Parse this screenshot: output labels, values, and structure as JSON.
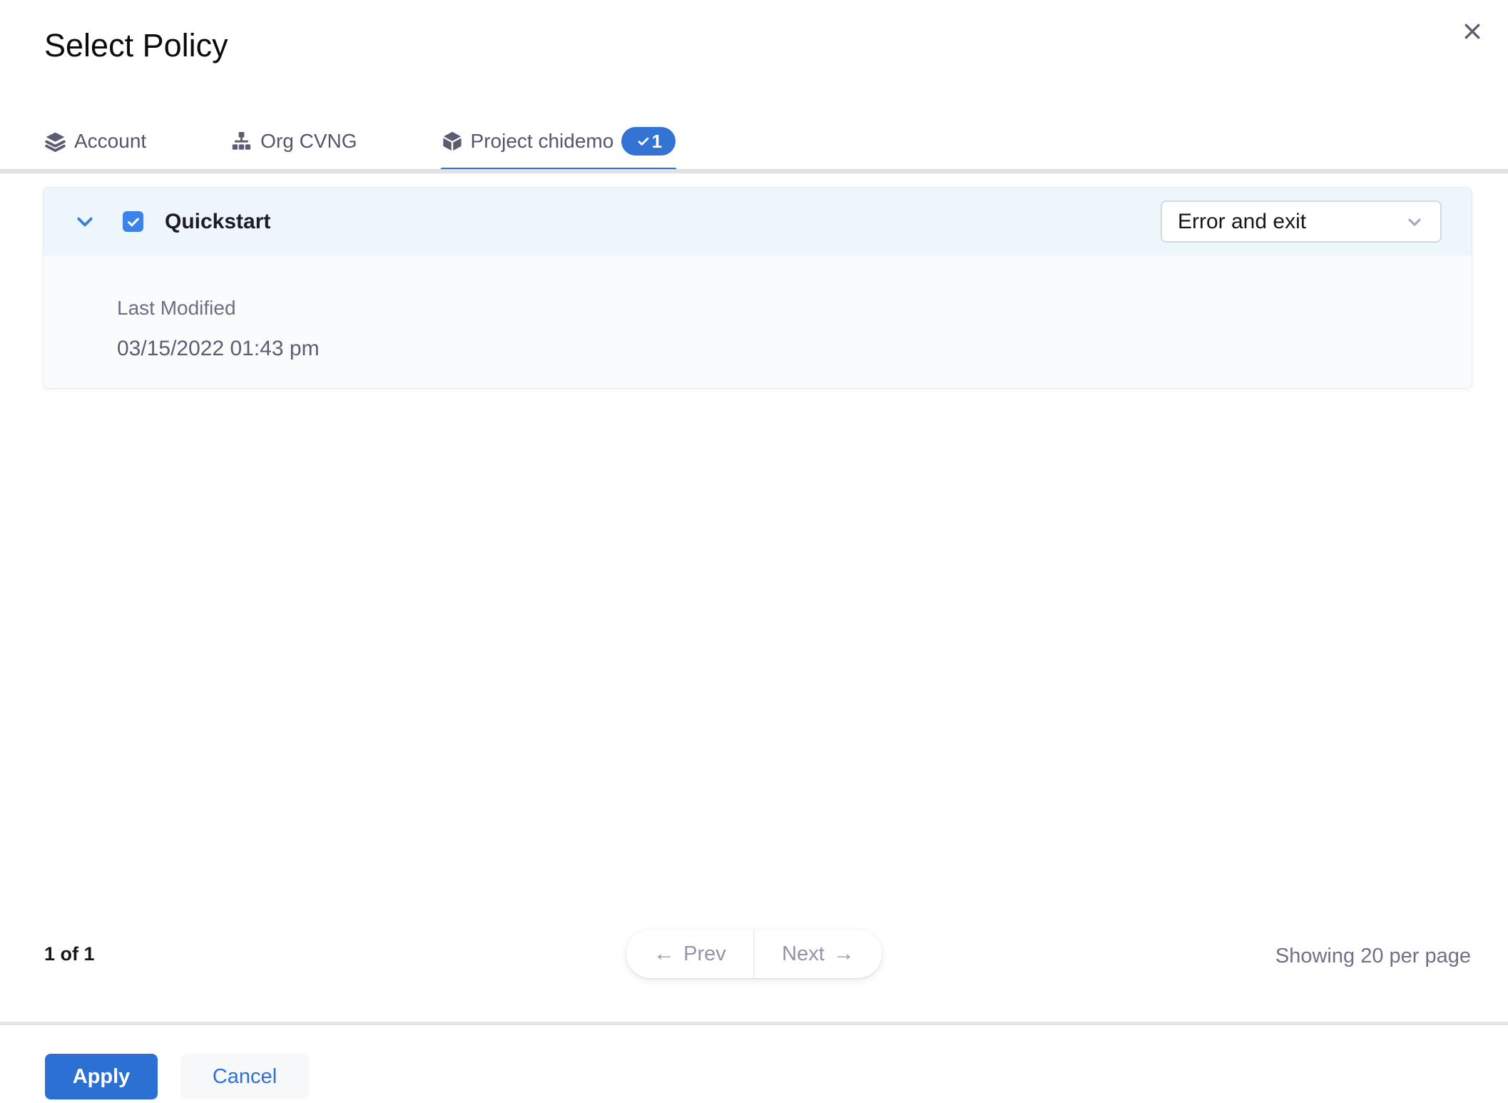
{
  "modal": {
    "title": "Select Policy"
  },
  "tabs": [
    {
      "label": "Account"
    },
    {
      "label": "Org CVNG"
    },
    {
      "label": "Project chidemo",
      "badge_count": "1"
    }
  ],
  "policy_row": {
    "name": "Quickstart",
    "action_select": {
      "value": "Error and exit"
    },
    "details": {
      "label": "Last Modified",
      "value": "03/15/2022 01:43 pm"
    }
  },
  "pagination": {
    "page_indicator": "1 of 1",
    "prev_label": "Prev",
    "next_label": "Next",
    "showing_label": "Showing 20 per page"
  },
  "footer": {
    "apply_label": "Apply",
    "cancel_label": "Cancel"
  },
  "icons": {
    "arrow_left": "←",
    "arrow_right": "→"
  },
  "colors": {
    "accent_blue": "#2d70d4",
    "tab_underline_blue": "#2b6fd6",
    "checkbox_blue": "#3c82e8",
    "badge_blue": "#3273d4",
    "panel_header_bg": "#edf6fa",
    "panel_body_bg": "#fafbfc"
  }
}
